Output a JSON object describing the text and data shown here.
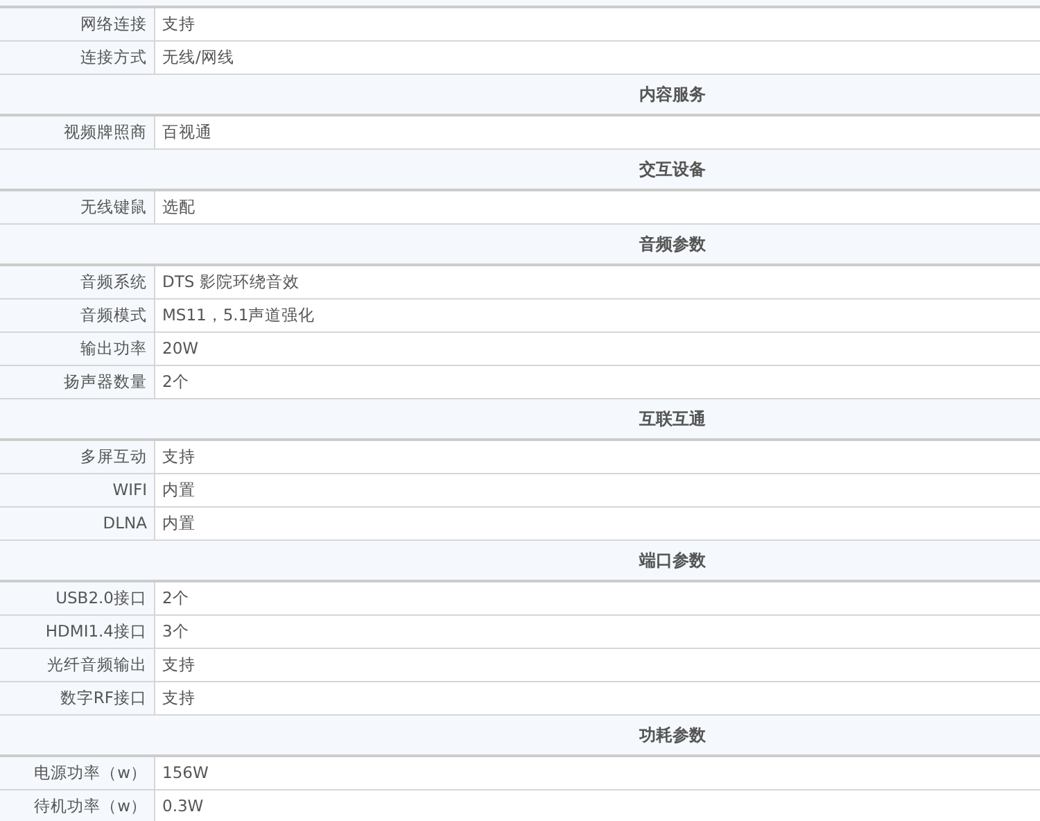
{
  "rows": [
    {
      "kind": "spec",
      "label": "网络连接",
      "value": "支持"
    },
    {
      "kind": "spec",
      "label": "连接方式",
      "value": "无线/网线"
    },
    {
      "kind": "section",
      "title": "内容服务"
    },
    {
      "kind": "spec",
      "label": "视频牌照商",
      "value": "百视通"
    },
    {
      "kind": "section",
      "title": "交互设备"
    },
    {
      "kind": "spec",
      "label": "无线键鼠",
      "value": "选配"
    },
    {
      "kind": "section",
      "title": "音频参数"
    },
    {
      "kind": "spec",
      "label": "音频系统",
      "value": "DTS 影院环绕音效"
    },
    {
      "kind": "spec",
      "label": "音频模式",
      "value": "MS11，5.1声道强化"
    },
    {
      "kind": "spec",
      "label": "输出功率",
      "value": "20W"
    },
    {
      "kind": "spec",
      "label": "扬声器数量",
      "value": "2个"
    },
    {
      "kind": "section",
      "title": "互联互通"
    },
    {
      "kind": "spec",
      "label": "多屏互动",
      "value": "支持"
    },
    {
      "kind": "spec",
      "label": "WIFI",
      "value": "内置"
    },
    {
      "kind": "spec",
      "label": "DLNA",
      "value": "内置"
    },
    {
      "kind": "section",
      "title": "端口参数"
    },
    {
      "kind": "spec",
      "label": "USB2.0接口",
      "value": "2个"
    },
    {
      "kind": "spec",
      "label": "HDMI1.4接口",
      "value": "3个"
    },
    {
      "kind": "spec",
      "label": "光纤音频输出",
      "value": "支持"
    },
    {
      "kind": "spec",
      "label": "数字RF接口",
      "value": "支持"
    },
    {
      "kind": "section",
      "title": "功耗参数"
    },
    {
      "kind": "spec",
      "label": "电源功率（w）",
      "value": "156W"
    },
    {
      "kind": "spec",
      "label": "待机功率（w）",
      "value": "0.3W"
    }
  ]
}
